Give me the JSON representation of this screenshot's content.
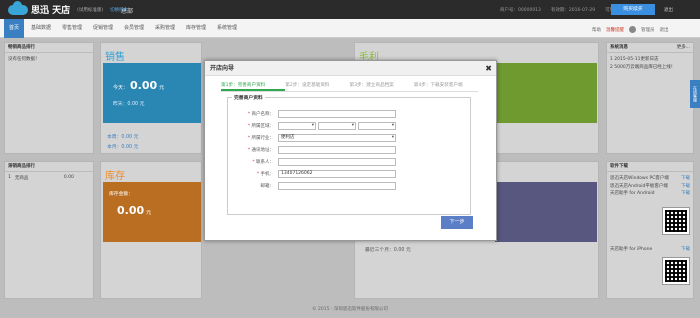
{
  "app": {
    "brand": "思迅 天店",
    "edition": "(试用标准版)",
    "edition_link": "切换版本",
    "top_title": "总部",
    "info": [
      "商户号：00000013",
      "有效期：2016-07-29",
      "可用：100 点"
    ],
    "buy_button": "购买续买",
    "exit_label": "退出"
  },
  "nav": {
    "items": [
      "首页",
      "基础数据",
      "零售管理",
      "促销管理",
      "会员管理",
      "采购管理",
      "库存管理",
      "系统管理"
    ],
    "active": 0,
    "help": "帮助",
    "tips": "温馨提醒",
    "user": "管理员",
    "logout": "退出"
  },
  "dashboard": {
    "left_top_title": "畅销商品排行",
    "left_top_body": "没有任何数据！",
    "left_bottom_title": "滞销商品排行",
    "left_bottom_row": {
      "idx": "1",
      "name": "无商品",
      "value": "0.00"
    },
    "sales": {
      "title": "销售",
      "today_label": "今天：",
      "today_value": "0.00",
      "unit": "元",
      "yesterday": "昨天：0.00 元",
      "week": "本周：0.00 元",
      "month": "本月：0.00 元",
      "color": "#2fa0d8"
    },
    "profit": {
      "title": "毛利",
      "color": "#8bbf3b"
    },
    "stock": {
      "title": "库存",
      "label": "库存金额：",
      "value": "0.00",
      "unit": "元",
      "color": "#ef8c2a"
    },
    "other": {
      "recent": "最近三个月：0.00 元",
      "color": "#6f6fa3"
    },
    "notice_title": "系统消息",
    "notice_more": "更多...",
    "notices": [
      "1 2015-05-11更新日志",
      "2 5000万云端商品库已经上线！"
    ],
    "downloads_title": "软件下载",
    "downloads": [
      {
        "name": "思迅天店Windows PC客户端",
        "action": "下载"
      },
      {
        "name": "思迅天店Android平板客户端",
        "action": "下载"
      },
      {
        "name": "天店助手 for Android",
        "action": "下载"
      },
      {
        "name": "天店助手 for iPhone",
        "action": "下载"
      }
    ]
  },
  "side_tab": "在线客服",
  "footer": "© 2015 - 深圳思迅软件股份有限公司",
  "modal": {
    "title": "开店向导",
    "close": "✖",
    "steps": [
      "第1步：完善商户资料",
      "第2步：设定基础资料",
      "第3步：建立商品档案",
      "第4步：下载安装客户端"
    ],
    "active_step": 0,
    "section": "完善商户资料",
    "fields": {
      "name_label": "商户名称",
      "name_value": "",
      "region_label": "所属区域",
      "industry_label": "所属行业",
      "industry_value": "便利店",
      "address_label": "通讯地址",
      "contact_label": "联系人",
      "phone_label": "手机",
      "phone_value": "13407126062",
      "email_label": "邮箱"
    },
    "next_button": "下一步"
  }
}
